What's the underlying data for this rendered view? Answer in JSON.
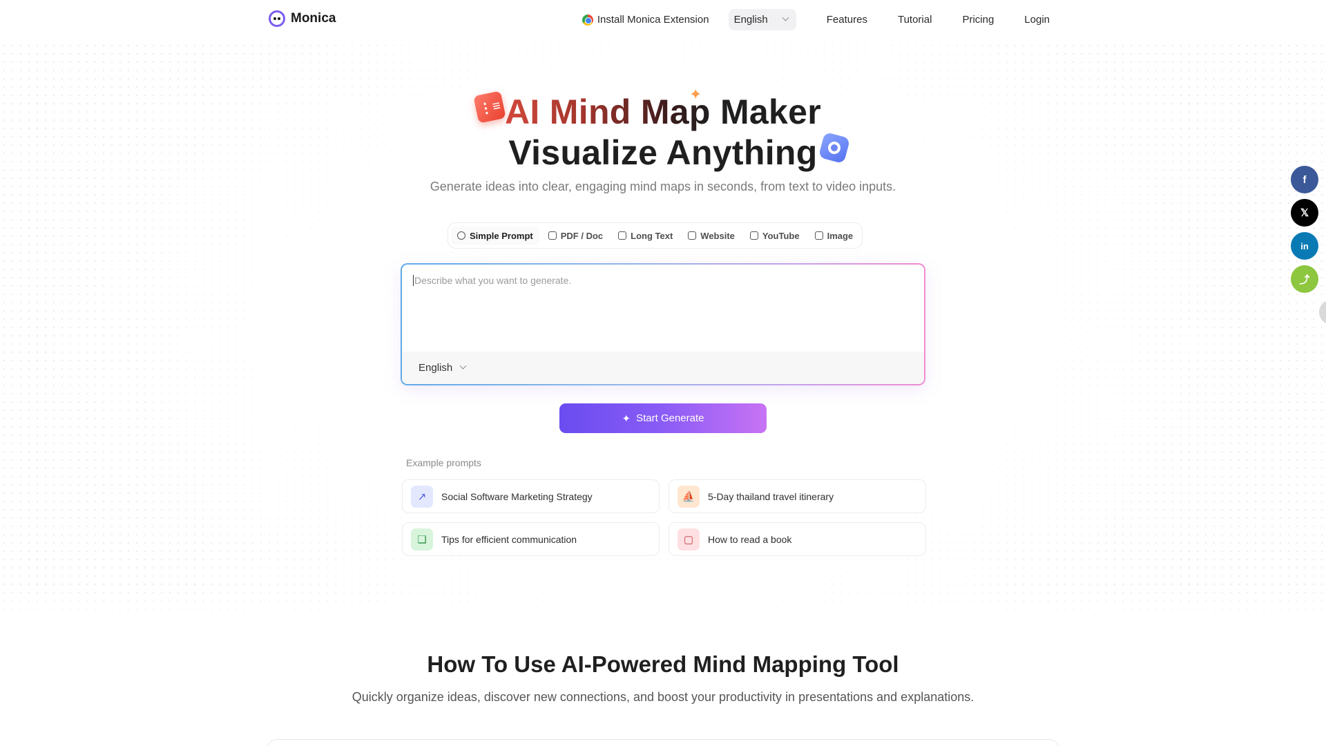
{
  "header": {
    "logo_text": "Monica",
    "nav": {
      "install_extension": "Install Monica Extension",
      "language": "English",
      "features": "Features",
      "tutorial": "Tutorial",
      "pricing": "Pricing",
      "login": "Login"
    }
  },
  "hero": {
    "title_part1": "AI Mind Map",
    "title_part2": "Maker",
    "title_line2": "Visualize Anything",
    "subtitle": "Generate ideas into clear, engaging mind maps in seconds, from text to video inputs."
  },
  "tabs": [
    {
      "label": "Simple Prompt",
      "icon": "chat-bubble-icon"
    },
    {
      "label": "PDF / Doc",
      "icon": "file-icon"
    },
    {
      "label": "Long Text",
      "icon": "document-icon"
    },
    {
      "label": "Website",
      "icon": "monitor-icon"
    },
    {
      "label": "YouTube",
      "icon": "play-icon"
    },
    {
      "label": "Image",
      "icon": "image-icon"
    }
  ],
  "prompt": {
    "placeholder": "Describe what you want to generate.",
    "language": "English"
  },
  "generate_button": "Start Generate",
  "examples": {
    "label": "Example prompts",
    "items": [
      {
        "label": "Social Software Marketing Strategy",
        "icon": "trend-chart-icon"
      },
      {
        "label": "5-Day thailand travel itinerary",
        "icon": "sailboat-icon"
      },
      {
        "label": "Tips for efficient communication",
        "icon": "chat-bubbles-icon"
      },
      {
        "label": "How to read a book",
        "icon": "open-book-icon"
      }
    ]
  },
  "section2": {
    "title": "How To Use AI-Powered Mind Mapping Tool",
    "subtitle": "Quickly organize ideas, discover new connections, and boost your productivity in presentations and explanations."
  },
  "social": {
    "facebook": "f",
    "x": "𝕏",
    "linkedin": "in",
    "share": "share-icon"
  },
  "colors": {
    "accent_purple": "#7b5cf0",
    "button_gradient_start": "#6a4cf0",
    "button_gradient_end": "#c873f4",
    "title_red": "#d1483b"
  }
}
